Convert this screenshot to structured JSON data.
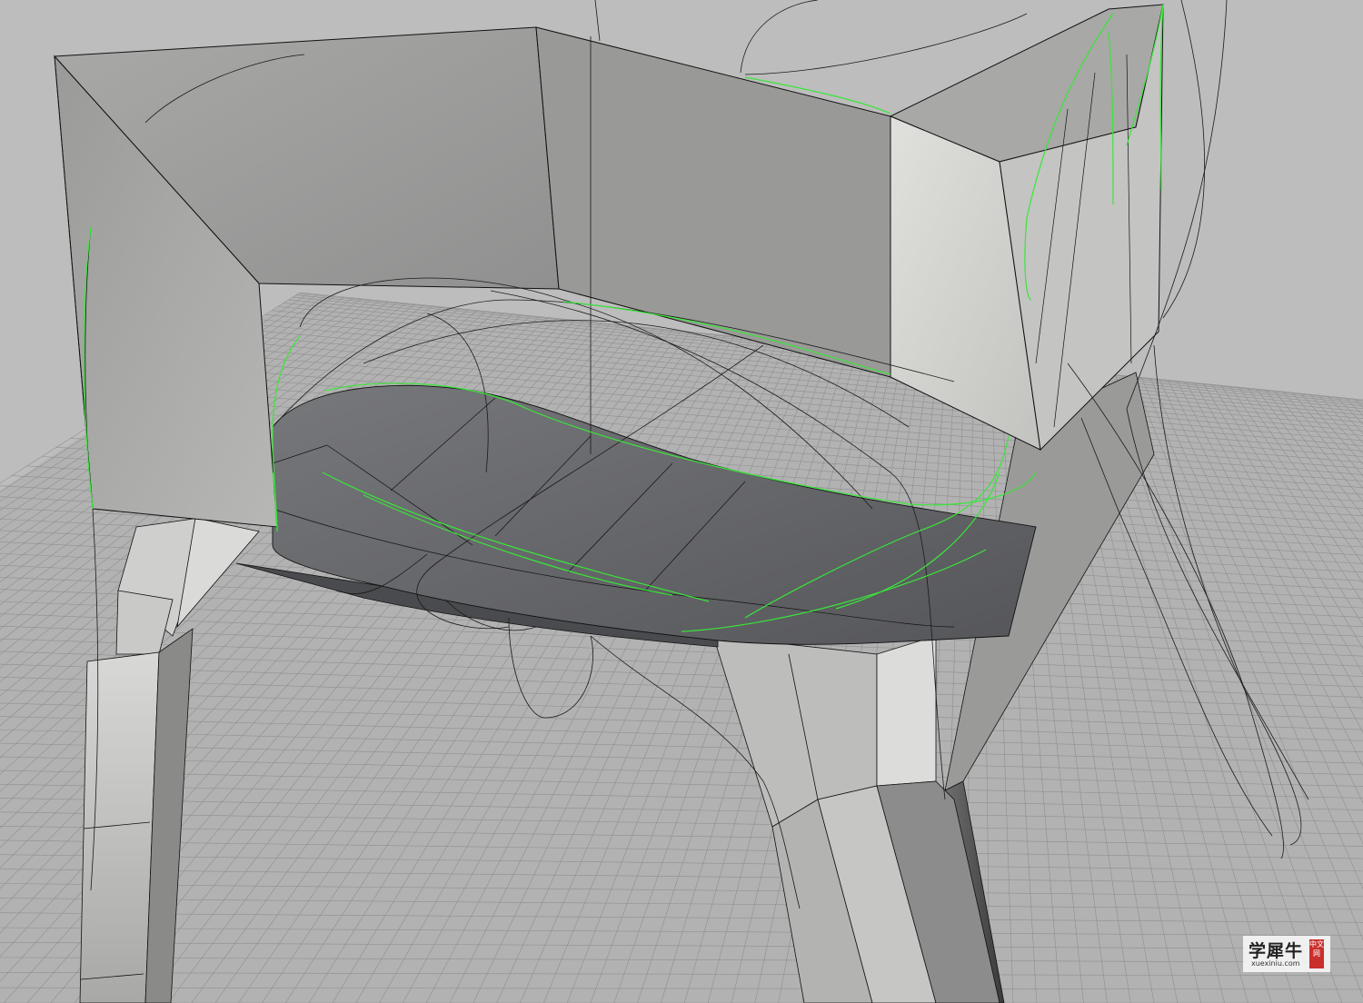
{
  "viewport": {
    "colors": {
      "background": "#bdbdbd",
      "grid_floor": "#b0b0b0",
      "grid_line": "#8e8e8e",
      "surface_light": "#d6d6d4",
      "surface_mid": "#a3a3a1",
      "surface_dark": "#66676a",
      "edge_line": "#111111",
      "highlight_curve": "#39e639"
    }
  },
  "watermark": {
    "main": "学犀牛",
    "seal": "中文网",
    "domain": "xuexiniu.com"
  }
}
